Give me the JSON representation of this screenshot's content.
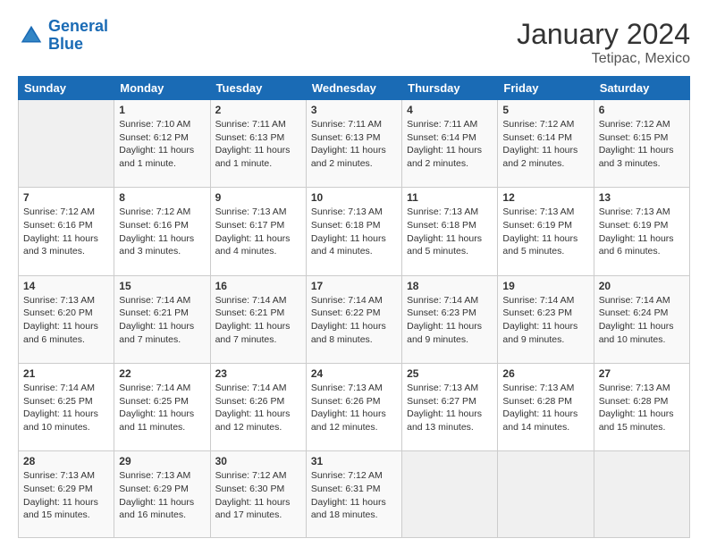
{
  "header": {
    "logo_line1": "General",
    "logo_line2": "Blue",
    "month_year": "January 2024",
    "location": "Tetipac, Mexico"
  },
  "days_of_week": [
    "Sunday",
    "Monday",
    "Tuesday",
    "Wednesday",
    "Thursday",
    "Friday",
    "Saturday"
  ],
  "weeks": [
    [
      {
        "day": "",
        "info": ""
      },
      {
        "day": "1",
        "info": "Sunrise: 7:10 AM\nSunset: 6:12 PM\nDaylight: 11 hours\nand 1 minute."
      },
      {
        "day": "2",
        "info": "Sunrise: 7:11 AM\nSunset: 6:13 PM\nDaylight: 11 hours\nand 1 minute."
      },
      {
        "day": "3",
        "info": "Sunrise: 7:11 AM\nSunset: 6:13 PM\nDaylight: 11 hours\nand 2 minutes."
      },
      {
        "day": "4",
        "info": "Sunrise: 7:11 AM\nSunset: 6:14 PM\nDaylight: 11 hours\nand 2 minutes."
      },
      {
        "day": "5",
        "info": "Sunrise: 7:12 AM\nSunset: 6:14 PM\nDaylight: 11 hours\nand 2 minutes."
      },
      {
        "day": "6",
        "info": "Sunrise: 7:12 AM\nSunset: 6:15 PM\nDaylight: 11 hours\nand 3 minutes."
      }
    ],
    [
      {
        "day": "7",
        "info": "Sunrise: 7:12 AM\nSunset: 6:16 PM\nDaylight: 11 hours\nand 3 minutes."
      },
      {
        "day": "8",
        "info": "Sunrise: 7:12 AM\nSunset: 6:16 PM\nDaylight: 11 hours\nand 3 minutes."
      },
      {
        "day": "9",
        "info": "Sunrise: 7:13 AM\nSunset: 6:17 PM\nDaylight: 11 hours\nand 4 minutes."
      },
      {
        "day": "10",
        "info": "Sunrise: 7:13 AM\nSunset: 6:18 PM\nDaylight: 11 hours\nand 4 minutes."
      },
      {
        "day": "11",
        "info": "Sunrise: 7:13 AM\nSunset: 6:18 PM\nDaylight: 11 hours\nand 5 minutes."
      },
      {
        "day": "12",
        "info": "Sunrise: 7:13 AM\nSunset: 6:19 PM\nDaylight: 11 hours\nand 5 minutes."
      },
      {
        "day": "13",
        "info": "Sunrise: 7:13 AM\nSunset: 6:19 PM\nDaylight: 11 hours\nand 6 minutes."
      }
    ],
    [
      {
        "day": "14",
        "info": "Sunrise: 7:13 AM\nSunset: 6:20 PM\nDaylight: 11 hours\nand 6 minutes."
      },
      {
        "day": "15",
        "info": "Sunrise: 7:14 AM\nSunset: 6:21 PM\nDaylight: 11 hours\nand 7 minutes."
      },
      {
        "day": "16",
        "info": "Sunrise: 7:14 AM\nSunset: 6:21 PM\nDaylight: 11 hours\nand 7 minutes."
      },
      {
        "day": "17",
        "info": "Sunrise: 7:14 AM\nSunset: 6:22 PM\nDaylight: 11 hours\nand 8 minutes."
      },
      {
        "day": "18",
        "info": "Sunrise: 7:14 AM\nSunset: 6:23 PM\nDaylight: 11 hours\nand 9 minutes."
      },
      {
        "day": "19",
        "info": "Sunrise: 7:14 AM\nSunset: 6:23 PM\nDaylight: 11 hours\nand 9 minutes."
      },
      {
        "day": "20",
        "info": "Sunrise: 7:14 AM\nSunset: 6:24 PM\nDaylight: 11 hours\nand 10 minutes."
      }
    ],
    [
      {
        "day": "21",
        "info": "Sunrise: 7:14 AM\nSunset: 6:25 PM\nDaylight: 11 hours\nand 10 minutes."
      },
      {
        "day": "22",
        "info": "Sunrise: 7:14 AM\nSunset: 6:25 PM\nDaylight: 11 hours\nand 11 minutes."
      },
      {
        "day": "23",
        "info": "Sunrise: 7:14 AM\nSunset: 6:26 PM\nDaylight: 11 hours\nand 12 minutes."
      },
      {
        "day": "24",
        "info": "Sunrise: 7:13 AM\nSunset: 6:26 PM\nDaylight: 11 hours\nand 12 minutes."
      },
      {
        "day": "25",
        "info": "Sunrise: 7:13 AM\nSunset: 6:27 PM\nDaylight: 11 hours\nand 13 minutes."
      },
      {
        "day": "26",
        "info": "Sunrise: 7:13 AM\nSunset: 6:28 PM\nDaylight: 11 hours\nand 14 minutes."
      },
      {
        "day": "27",
        "info": "Sunrise: 7:13 AM\nSunset: 6:28 PM\nDaylight: 11 hours\nand 15 minutes."
      }
    ],
    [
      {
        "day": "28",
        "info": "Sunrise: 7:13 AM\nSunset: 6:29 PM\nDaylight: 11 hours\nand 15 minutes."
      },
      {
        "day": "29",
        "info": "Sunrise: 7:13 AM\nSunset: 6:29 PM\nDaylight: 11 hours\nand 16 minutes."
      },
      {
        "day": "30",
        "info": "Sunrise: 7:12 AM\nSunset: 6:30 PM\nDaylight: 11 hours\nand 17 minutes."
      },
      {
        "day": "31",
        "info": "Sunrise: 7:12 AM\nSunset: 6:31 PM\nDaylight: 11 hours\nand 18 minutes."
      },
      {
        "day": "",
        "info": ""
      },
      {
        "day": "",
        "info": ""
      },
      {
        "day": "",
        "info": ""
      }
    ]
  ]
}
